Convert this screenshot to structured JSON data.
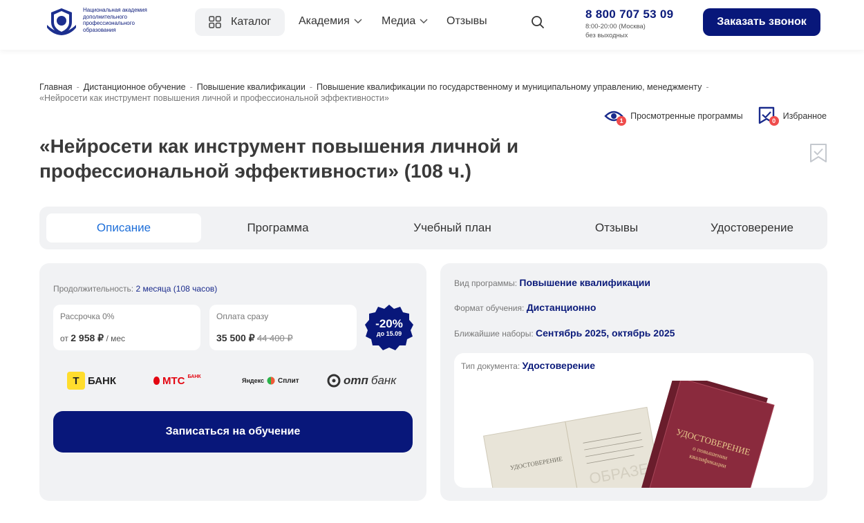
{
  "header": {
    "logo_text": "Национальная академия дополнительного профессионального образования",
    "catalog_label": "Каталог",
    "nav": [
      {
        "label": "Академия"
      },
      {
        "label": "Медиа"
      },
      {
        "label": "Отзывы"
      }
    ],
    "phone": "8 800 707 53 09",
    "hours_line1": "8:00-20:00 (Москва)",
    "hours_line2": "без выходных",
    "call_button": "Заказать звонок"
  },
  "breadcrumb": [
    "Главная",
    "Дистанционное обучение",
    "Повышение квалификации",
    "Повышение квалификации по государственному и муниципальному управлению, менеджменту",
    "«Нейросети как инструмент повышения личной и профессиональной эффективности»"
  ],
  "quick_links": {
    "viewed_label": "Просмотренные программы",
    "viewed_count": "1",
    "favorites_label": "Избранное",
    "favorites_count": "0"
  },
  "title": "«Нейросети как инструмент повышения личной и профессиональной эффективности» (108 ч.)",
  "tabs": [
    {
      "label": "Описание"
    },
    {
      "label": "Программа"
    },
    {
      "label": "Учебный план"
    },
    {
      "label": "Отзывы"
    },
    {
      "label": "Удостоверение"
    }
  ],
  "pricing": {
    "duration_label": "Продолжительность:",
    "duration_value": "2 месяца (108 часов)",
    "installment_label": "Рассрочка 0%",
    "installment_prefix": "от",
    "installment_price": "2 958 ₽",
    "installment_suffix": "/ мес",
    "full_label": "Оплата сразу",
    "full_price": "35 500 ₽",
    "old_price": "44 400 ₽",
    "discount_pct": "-20%",
    "discount_until": "до 15.09",
    "banks": [
      "БАНК",
      "МТС",
      "БАНК",
      "Яндекс",
      "Сплит",
      "отп",
      "банк"
    ],
    "enroll_button": "Записаться на обучение"
  },
  "program_info": {
    "type_label": "Вид программы:",
    "type_value": "Повышение квалификации",
    "format_label": "Формат обучения:",
    "format_value": "Дистанционно",
    "intake_label": "Ближайшие наборы:",
    "intake_value": "Сентябрь 2025, октябрь 2025",
    "doc_label": "Тип документа:",
    "doc_value": "Удостоверение"
  },
  "doc_image_text": {
    "cover_title": "УДОСТОВЕРЕНИЕ",
    "cover_sub1": "о повышении",
    "cover_sub2": "квалификации",
    "inner_title": "УДОСТОВЕРЕНИЕ",
    "watermark": "ОБРАЗЕЦ"
  },
  "colors": {
    "brand_navy": "#08177a",
    "link_blue": "#1e6fd9",
    "badge_red": "#ef4c4c",
    "panel_gray": "#f1f2f4"
  }
}
